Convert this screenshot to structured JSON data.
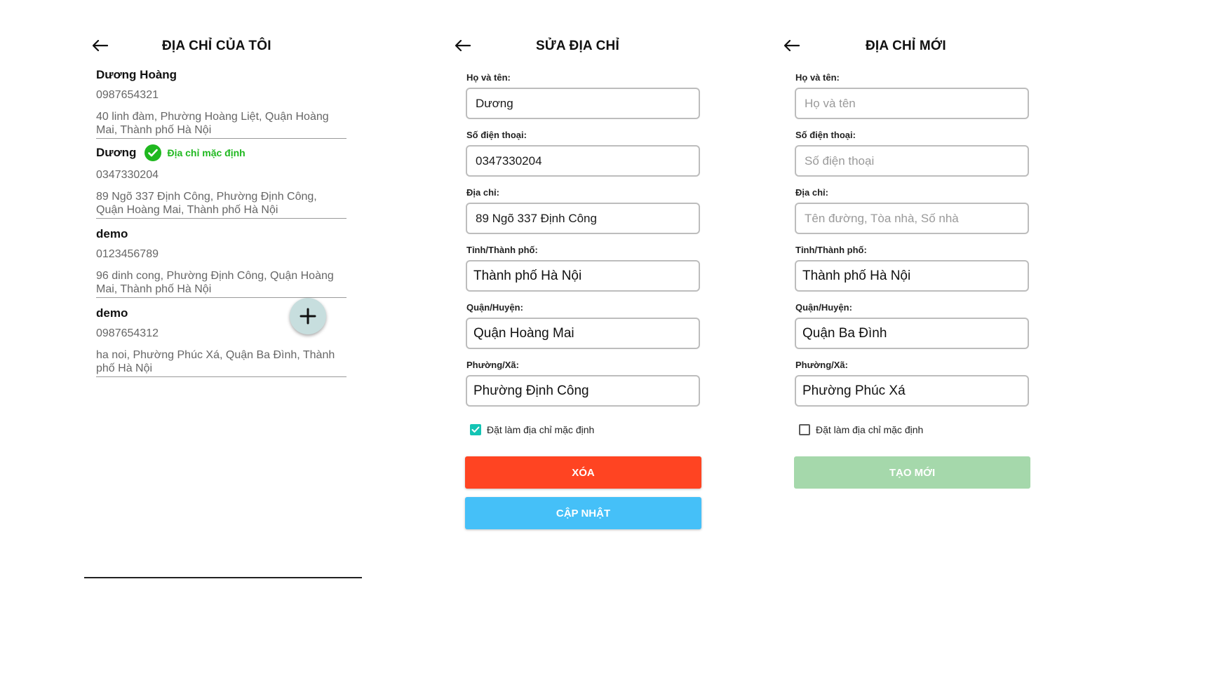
{
  "colors": {
    "default_green": "#1fb81f",
    "delete_button": "#ff4422",
    "update_button": "#45c0f8",
    "create_button_disabled": "#a5d8ab",
    "checkbox_checked": "#14c4b4",
    "fab_background": "#c7dede"
  },
  "list_screen": {
    "title": "ĐỊA CHỈ CỦA TÔI",
    "back_icon": "arrow-left-icon",
    "default_label": "Địa chỉ mặc định",
    "addresses": [
      {
        "name": "Dương Hoàng",
        "phone": "0987654321",
        "address": "40 linh đàm, Phường Hoàng Liệt, Quận Hoàng Mai, Thành phố Hà Nội",
        "is_default": false
      },
      {
        "name": "Dương",
        "phone": "0347330204",
        "address": "89 Ngõ 337 Định Công, Phường Định Công, Quận Hoàng Mai, Thành phố Hà Nội",
        "is_default": true
      },
      {
        "name": "demo",
        "phone": "0123456789",
        "address": "96 dinh cong, Phường Định Công, Quận Hoàng Mai, Thành phố Hà Nội",
        "is_default": false
      },
      {
        "name": "demo",
        "phone": "0987654312",
        "address": "ha noi, Phường Phúc Xá, Quận Ba Đình, Thành phố Hà Nội",
        "is_default": false
      }
    ],
    "fab_icon": "plus-icon"
  },
  "edit_screen": {
    "title": "SỬA ĐỊA CHỈ",
    "fields": {
      "name_label": "Họ và tên:",
      "name_value": "Dương",
      "phone_label": "Số điện thoại:",
      "phone_value": "0347330204",
      "address_label": "Địa chỉ:",
      "address_value": "89 Ngõ 337 Định Công",
      "province_label": "Tỉnh/Thành phố:",
      "province_value": "Thành phố Hà Nội",
      "district_label": "Quận/Huyện:",
      "district_value": "Quận Hoàng Mai",
      "ward_label": "Phường/Xã:",
      "ward_value": "Phường Định Công"
    },
    "default_checkbox_label": "Đặt làm địa chỉ mặc định",
    "default_checked": true,
    "delete_label": "XÓA",
    "update_label": "CẬP NHẬT"
  },
  "new_screen": {
    "title": "ĐỊA CHỈ MỚI",
    "fields": {
      "name_label": "Họ và tên:",
      "name_placeholder": "Họ và tên",
      "phone_label": "Số điện thoại:",
      "phone_placeholder": "Số điện thoại",
      "address_label": "Địa chỉ:",
      "address_placeholder": "Tên đường, Tòa nhà, Số nhà",
      "province_label": "Tỉnh/Thành phố:",
      "province_value": "Thành phố Hà Nội",
      "district_label": "Quận/Huyện:",
      "district_value": "Quận Ba Đình",
      "ward_label": "Phường/Xã:",
      "ward_value": "Phường Phúc Xá"
    },
    "default_checkbox_label": "Đặt làm địa chỉ mặc định",
    "default_checked": false,
    "create_label": "TẠO MỚI"
  }
}
